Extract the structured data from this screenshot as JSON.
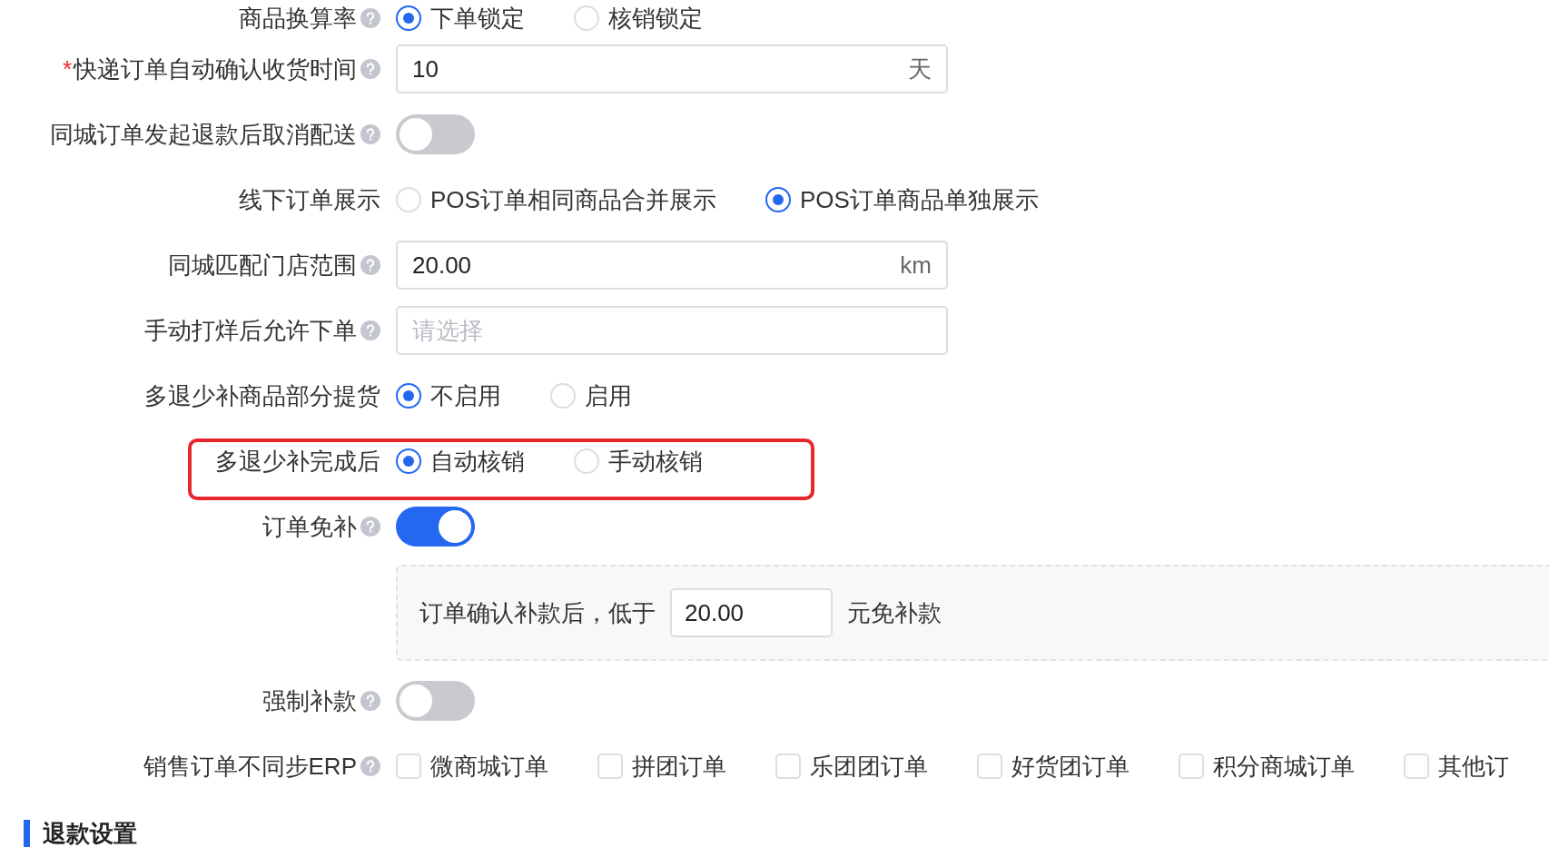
{
  "rows": [
    {
      "kind": "radio",
      "label": "商品换算率",
      "help": true,
      "options": [
        {
          "label": "下单锁定",
          "selected": true
        },
        {
          "label": "核销锁定",
          "selected": false
        }
      ]
    },
    {
      "kind": "input",
      "label": "快递订单自动确认收货时间",
      "required_mark": "*",
      "help": true,
      "value": "10",
      "suffix": "天"
    },
    {
      "kind": "switch",
      "label": "同城订单发起退款后取消配送",
      "help": true,
      "on": false
    },
    {
      "kind": "radio",
      "label": "线下订单展示",
      "options": [
        {
          "label": "POS订单相同商品合并展示",
          "selected": false
        },
        {
          "label": "POS订单商品单独展示",
          "selected": true
        }
      ]
    },
    {
      "kind": "input",
      "label": "同城匹配门店范围",
      "help": true,
      "value": "20.00",
      "suffix": "km"
    },
    {
      "kind": "select",
      "label": "手动打烊后允许下单",
      "help": true,
      "placeholder": "请选择"
    },
    {
      "kind": "radio",
      "label": "多退少补商品部分提货",
      "options": [
        {
          "label": "不启用",
          "selected": true
        },
        {
          "label": "启用",
          "selected": false
        }
      ]
    },
    {
      "kind": "radio",
      "label": "多退少补完成后",
      "highlighted": true,
      "options": [
        {
          "label": "自动核销",
          "selected": true
        },
        {
          "label": "手动核销",
          "selected": false
        }
      ]
    },
    {
      "kind": "switch",
      "label": "订单免补",
      "help": true,
      "on": true,
      "detail": {
        "before": "订单确认补款后，低于",
        "value": "20.00",
        "after": "元免补款"
      }
    },
    {
      "kind": "switch",
      "label": "强制补款",
      "help": true,
      "on": false
    },
    {
      "kind": "checkbox",
      "label": "销售订单不同步ERP",
      "help": true,
      "options": [
        {
          "label": "微商城订单",
          "checked": false
        },
        {
          "label": "拼团订单",
          "checked": false
        },
        {
          "label": "乐团团订单",
          "checked": false
        },
        {
          "label": "好货团订单",
          "checked": false
        },
        {
          "label": "积分商城订单",
          "checked": false
        },
        {
          "label": "其他订",
          "checked": false
        }
      ]
    }
  ],
  "section_title": "退款设置"
}
